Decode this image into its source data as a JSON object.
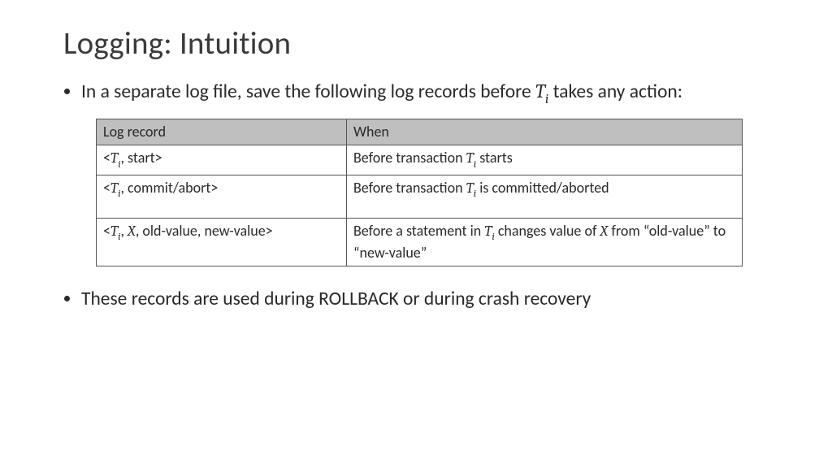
{
  "title": "Logging: Intuition",
  "bullets": {
    "b1_a": "In a separate log file, save the following log records before ",
    "b1_b": " takes any action:",
    "b2": "These records are used during ROLLBACK or during crash recovery"
  },
  "tvar": "T",
  "tsub": "i",
  "xvar": "X",
  "table": {
    "h1": "Log record",
    "h2": "When",
    "r1": {
      "c1_suffix": ", start>",
      "c2_a": "Before transaction ",
      "c2_b": " starts"
    },
    "r2": {
      "c1_suffix": ", commit/abort>",
      "c2_a": "Before transaction ",
      "c2_b": " is committed/aborted"
    },
    "r3": {
      "c1_mid": ", ",
      "c1_suffix": ", old-value, new-value>",
      "c2_a": "Before a statement in ",
      "c2_b": " changes value of ",
      "c2_c": " from “old-value” to “new-value”"
    }
  },
  "angle_open": "<"
}
